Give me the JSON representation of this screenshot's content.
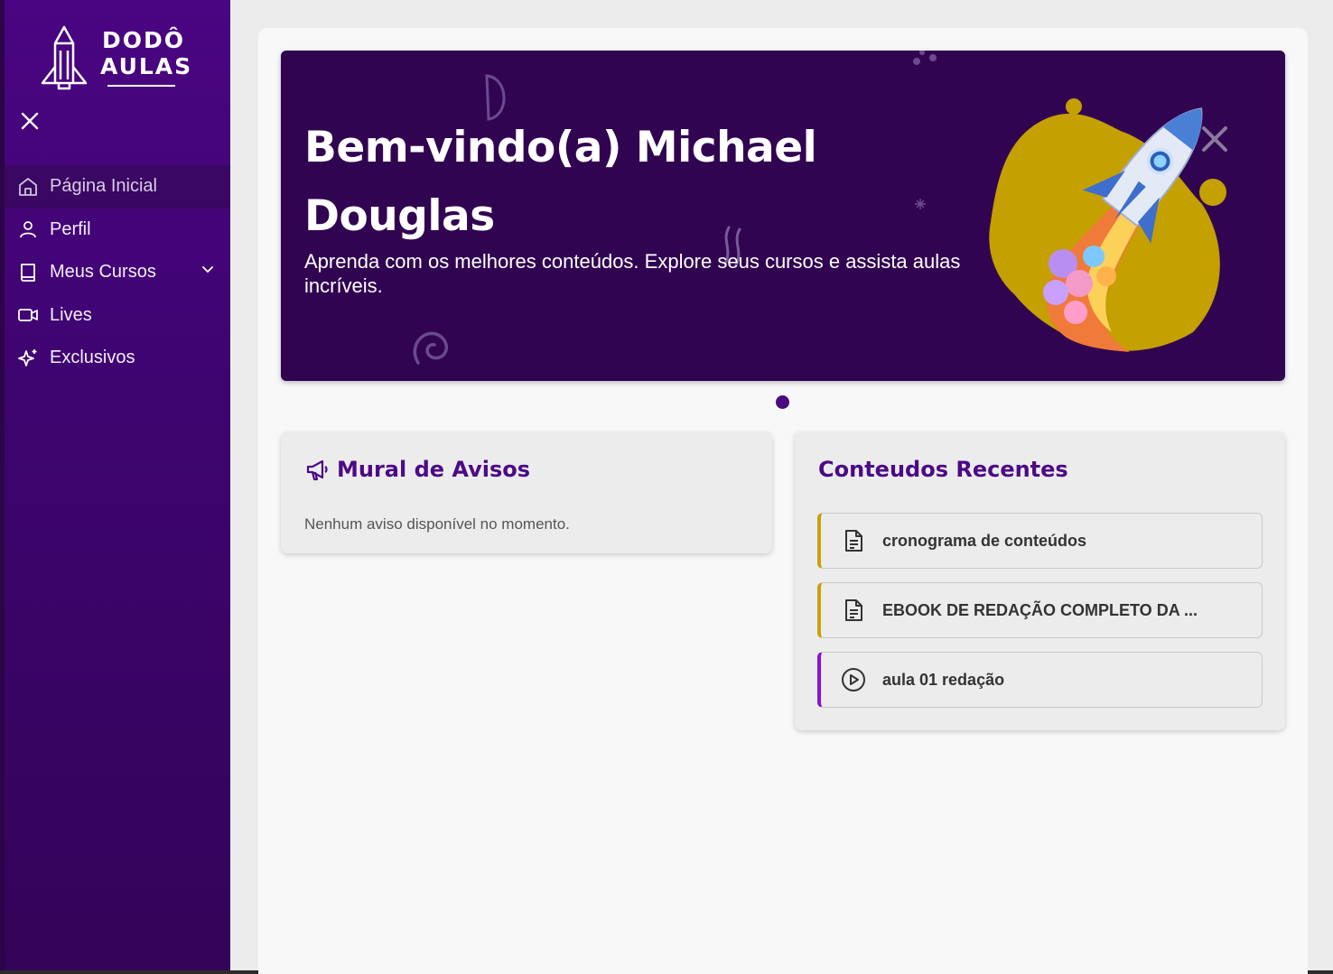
{
  "sidebar": {
    "logo": {
      "line1": "DODÔ",
      "line2": "AULAS"
    },
    "items": [
      {
        "label": "Página Inicial",
        "icon": "home-icon",
        "active": true
      },
      {
        "label": "Perfil",
        "icon": "user-icon"
      },
      {
        "label": "Meus Cursos",
        "icon": "book-icon",
        "has_submenu": true
      },
      {
        "label": "Lives",
        "icon": "video-icon"
      },
      {
        "label": "Exclusivos",
        "icon": "sparkles-icon"
      }
    ]
  },
  "banner": {
    "title": "Bem-vindo(a) Michael Douglas",
    "subtitle": "Aprenda com os melhores conteúdos. Explore seus cursos e assista aulas incríveis.",
    "illustration": "rocket-illustration"
  },
  "mural": {
    "title": "Mural de Avisos",
    "icon": "megaphone-icon",
    "empty_text": "Nenhum aviso disponível no momento."
  },
  "recent": {
    "title": "Conteudos Recentes",
    "items": [
      {
        "label": "cronograma de conteúdos",
        "icon": "document-icon",
        "accent": "#c9a10a"
      },
      {
        "label": "EBOOK DE REDAÇÃO COMPLETO DA ...",
        "icon": "document-icon",
        "accent": "#c9a10a"
      },
      {
        "label": "aula 01 redação",
        "icon": "play-circle-icon",
        "accent": "#8a12d6"
      }
    ]
  },
  "colors": {
    "sidebar": "#4a0582",
    "banner": "#310451",
    "accent_purple": "#4c0a86",
    "blob_gold": "#c4a000"
  }
}
